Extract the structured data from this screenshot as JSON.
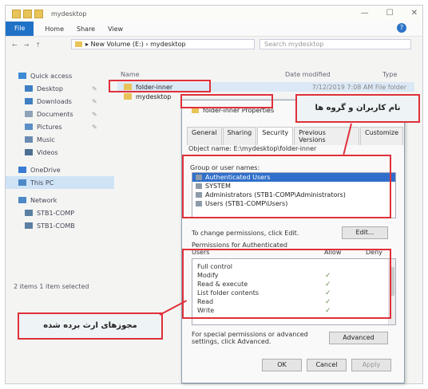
{
  "window": {
    "title": "mydesktop",
    "controls": [
      "—",
      "☐",
      "✕"
    ]
  },
  "ribbon": {
    "file_tab": "File",
    "tabs": [
      "Home",
      "Share",
      "View"
    ],
    "help": "?"
  },
  "address": {
    "nav": [
      "←",
      "→",
      "↑"
    ],
    "path": "▸ New Volume (E:) › mydesktop",
    "search_placeholder": "Search mydesktop"
  },
  "columns": {
    "name": "Name",
    "date": "Date modified",
    "type": "Type"
  },
  "navpane": {
    "items": [
      {
        "label": "Quick access",
        "icon_color": "#3d8ad6"
      },
      {
        "label": "Desktop",
        "icon_color": "#3d7fc2",
        "pinned": true
      },
      {
        "label": "Downloads",
        "icon_color": "#3d7fc2",
        "pinned": true
      },
      {
        "label": "Documents",
        "icon_color": "#8fa3b8",
        "pinned": true
      },
      {
        "label": "Pictures",
        "icon_color": "#5b8fc7",
        "pinned": true
      },
      {
        "label": "Music",
        "icon_color": "#6a8bb0"
      },
      {
        "label": "Videos",
        "icon_color": "#4d6f92"
      },
      {
        "label": "OneDrive",
        "icon_color": "#3a7bd5"
      },
      {
        "label": "This PC",
        "icon_color": "#4d88c6"
      },
      {
        "label": "Network",
        "icon_color": "#4d88c6"
      },
      {
        "label": "STB1-COMP",
        "icon_color": "#5a7fa3"
      },
      {
        "label": "STB1-COMB",
        "icon_color": "#5a7fa3"
      }
    ],
    "pin_glyph": "✎"
  },
  "files": [
    {
      "name": "folder-inner",
      "meta": "7/12/2019 7:08 AM    File folder"
    },
    {
      "name": "mydesktop",
      "meta": ""
    }
  ],
  "status": "2 items    1 item selected",
  "dialog": {
    "title": "folder-inner Properties",
    "tabs": [
      "General",
      "Sharing",
      "Security",
      "Previous Versions",
      "Customize"
    ],
    "object_name": "Object name:   E:\\mydesktop\\folder-inner",
    "group_label": "Group or user names:",
    "groups": [
      "Authenticated Users",
      "SYSTEM",
      "Administrators (STB1-COMP\\Administrators)",
      "Users (STB1-COMP\\Users)"
    ],
    "change_text": "To change permissions, click Edit.",
    "edit_button": "Edit...",
    "perm_label": "Permissions for Authenticated Users",
    "allow": "Allow",
    "deny": "Deny",
    "permissions": [
      {
        "name": "Full control",
        "allow": false
      },
      {
        "name": "Modify",
        "allow": true
      },
      {
        "name": "Read & execute",
        "allow": true
      },
      {
        "name": "List folder contents",
        "allow": true
      },
      {
        "name": "Read",
        "allow": true
      },
      {
        "name": "Write",
        "allow": true
      }
    ],
    "check_glyph": "✓",
    "special_text": "For special permissions or advanced settings, click Advanced.",
    "advanced_button": "Advanced",
    "ok": "OK",
    "cancel": "Cancel",
    "apply": "Apply"
  },
  "annotations": {
    "users_callout": "نام کاربران و گروه ها",
    "perms_callout": "مجوزهای ارث برده شده",
    "color": "#e0303a"
  }
}
